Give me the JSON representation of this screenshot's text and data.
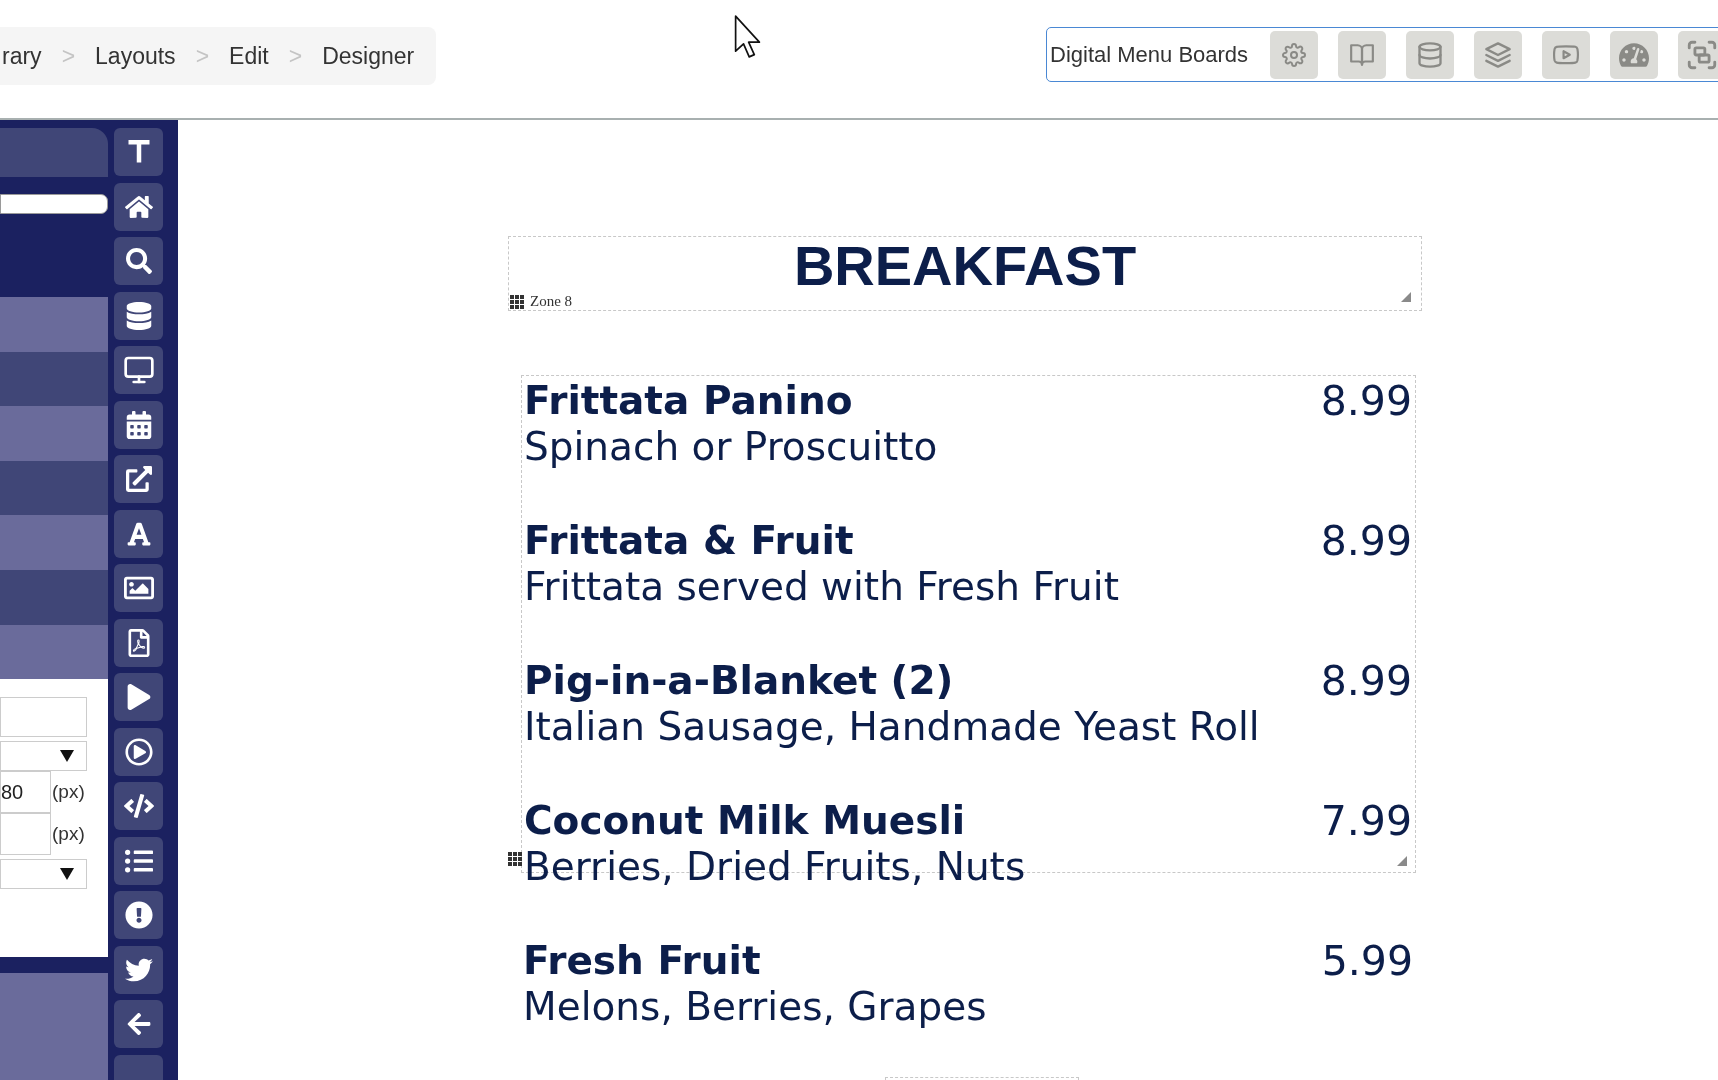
{
  "breadcrumb": [
    {
      "kind": "link",
      "text": "rary"
    },
    {
      "kind": "separator",
      "text": ">"
    },
    {
      "kind": "link",
      "text": "Layouts"
    },
    {
      "kind": "separator",
      "text": ">"
    },
    {
      "kind": "link",
      "text": "Edit"
    },
    {
      "kind": "separator",
      "text": ">"
    },
    {
      "kind": "link",
      "text": "Designer"
    }
  ],
  "toolbar": {
    "title": "Digital Menu Boards"
  },
  "properties_panel": {
    "fields": [
      {
        "kind": "text"
      },
      {
        "kind": "select"
      },
      {
        "kind": "number",
        "value": "80",
        "unit": "(px)"
      },
      {
        "kind": "number",
        "unit": "(px)"
      },
      {
        "kind": "select"
      }
    ]
  },
  "canvas": {
    "title_zone": {
      "title": "BREAKFAST",
      "label": "Zone 8"
    },
    "item_zone": {
      "items": [
        {
          "name": "Frittata Panino",
          "description": "Spinach or Proscuitto",
          "price": "8.99"
        },
        {
          "name": "Frittata & Fruit",
          "description": "Frittata served with Fresh Fruit",
          "price": "8.99"
        },
        {
          "name": "Pig-in-a-Blanket (2)",
          "description": "Italian Sausage, Handmade Yeast Roll",
          "price": "8.99"
        },
        {
          "name": "Coconut Milk Muesli",
          "description": "Berries, Dried Fruits, Nuts",
          "price": "7.99"
        }
      ]
    },
    "items_below_zone": [
      {
        "name": "Fresh Fruit",
        "description": "Melons, Berries, Grapes",
        "price": "5.99"
      }
    ]
  }
}
